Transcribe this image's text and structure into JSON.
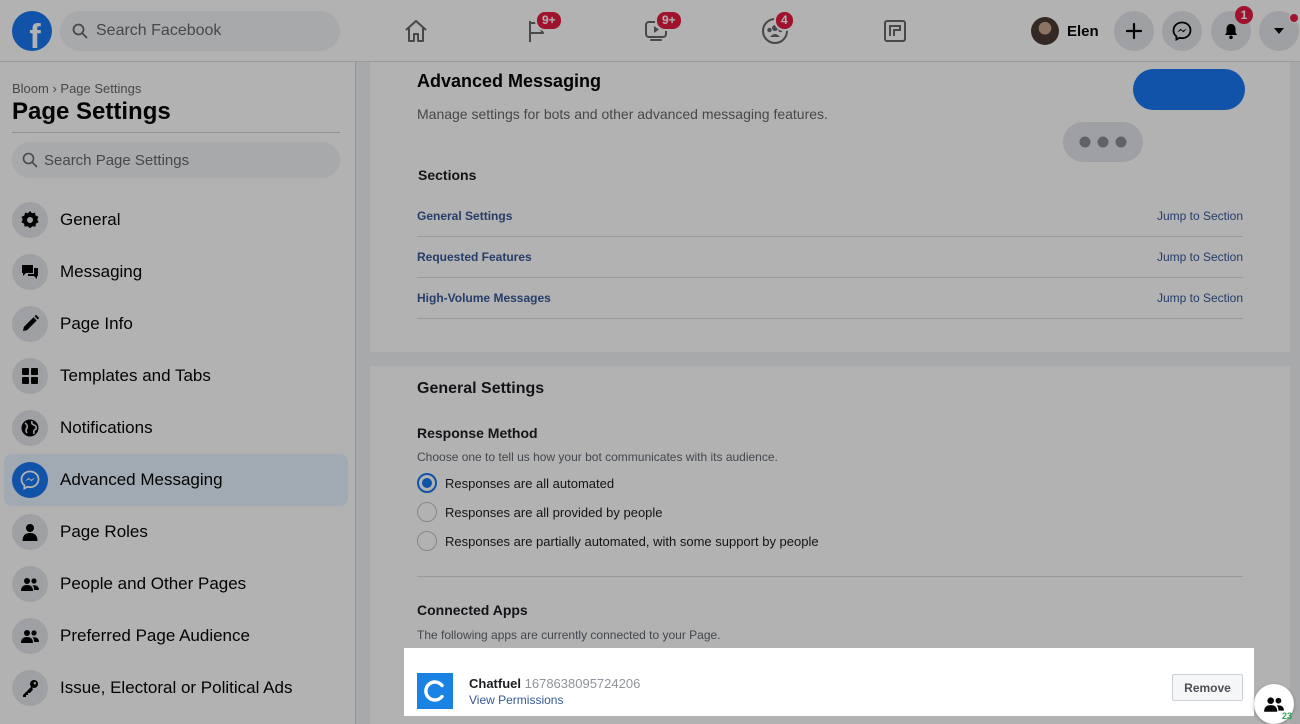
{
  "topbar": {
    "search_placeholder": "Search Facebook",
    "nav_badges": {
      "pages": "9+",
      "watch": "9+",
      "groups": "4"
    },
    "profile_name": "Elen",
    "notifications_count": "1"
  },
  "sidebar": {
    "breadcrumb": "Bloom › Page Settings",
    "title": "Page Settings",
    "search_placeholder": "Search Page Settings",
    "items": [
      {
        "label": "General",
        "icon": "gear-icon"
      },
      {
        "label": "Messaging",
        "icon": "chat-bubbles-icon"
      },
      {
        "label": "Page Info",
        "icon": "pencil-icon"
      },
      {
        "label": "Templates and Tabs",
        "icon": "grid-icon"
      },
      {
        "label": "Notifications",
        "icon": "globe-icon"
      },
      {
        "label": "Advanced Messaging",
        "icon": "messenger-icon"
      },
      {
        "label": "Page Roles",
        "icon": "person-icon"
      },
      {
        "label": "People and Other Pages",
        "icon": "people-icon"
      },
      {
        "label": "Preferred Page Audience",
        "icon": "people-icon"
      },
      {
        "label": "Issue, Electoral or Political Ads",
        "icon": "key-icon"
      }
    ],
    "active_item": "Advanced Messaging"
  },
  "advanced": {
    "title": "Advanced Messaging",
    "description": "Manage settings for bots and other advanced messaging features.",
    "sections_label": "Sections",
    "sections": [
      {
        "name": "General Settings",
        "action": "Jump to Section"
      },
      {
        "name": "Requested Features",
        "action": "Jump to Section"
      },
      {
        "name": "High-Volume Messages",
        "action": "Jump to Section"
      }
    ]
  },
  "general": {
    "title": "General Settings",
    "response_method_label": "Response Method",
    "response_method_desc": "Choose one to tell us how your bot communicates with its audience.",
    "options": [
      "Responses are all automated",
      "Responses are all provided by people",
      "Responses are partially automated, with some support by people"
    ],
    "selected_option": "Responses are all automated",
    "connected_apps_label": "Connected Apps",
    "connected_apps_desc": "The following apps are currently connected to your Page."
  },
  "app": {
    "name": "Chatfuel",
    "id": "1678638095724206",
    "link": "View Permissions",
    "remove_label": "Remove",
    "logo_letter": "C"
  },
  "contacts": {
    "count": "23"
  },
  "colors": {
    "brand": "#1877f2",
    "link": "#385898",
    "badge": "#e41e3f"
  }
}
